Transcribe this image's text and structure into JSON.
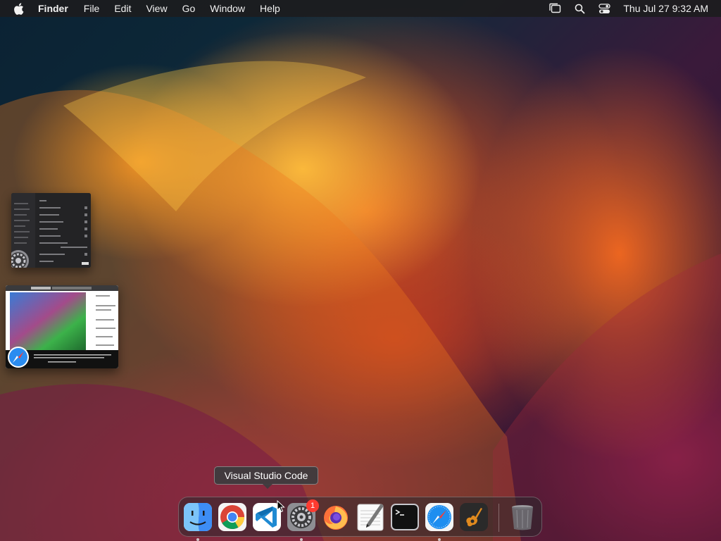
{
  "menubar": {
    "app_name": "Finder",
    "menus": [
      "File",
      "Edit",
      "View",
      "Go",
      "Window",
      "Help"
    ],
    "clock": "Thu Jul 27  9:32 AM",
    "status_icons": [
      "stage-manager-icon",
      "search-icon",
      "control-center-icon"
    ]
  },
  "stage_manager": {
    "windows": [
      {
        "app": "System Settings",
        "icon": "system-settings-icon"
      },
      {
        "app": "Safari",
        "icon": "safari-icon"
      }
    ]
  },
  "tooltip": {
    "text": "Visual Studio Code"
  },
  "dock": {
    "items": [
      {
        "name": "Finder",
        "icon": "finder-icon",
        "running": true
      },
      {
        "name": "Google Chrome",
        "icon": "chrome-icon",
        "running": false
      },
      {
        "name": "Visual Studio Code",
        "icon": "vscode-icon",
        "running": false
      },
      {
        "name": "System Settings",
        "icon": "system-settings-icon",
        "running": true,
        "badge": "1"
      },
      {
        "name": "Firefox",
        "icon": "firefox-icon",
        "running": false
      },
      {
        "name": "TextEdit",
        "icon": "textedit-icon",
        "running": false
      },
      {
        "name": "Terminal",
        "icon": "terminal-icon",
        "running": false
      },
      {
        "name": "Safari",
        "icon": "safari-icon",
        "running": true
      },
      {
        "name": "GarageBand",
        "icon": "garageband-icon",
        "running": false
      },
      {
        "name": "Trash",
        "icon": "trash-icon",
        "running": false
      }
    ]
  },
  "colors": {
    "menubar_bg": "#1c1c1e",
    "badge": "#ff3b30",
    "accent_orange": "#ff8a1e"
  }
}
